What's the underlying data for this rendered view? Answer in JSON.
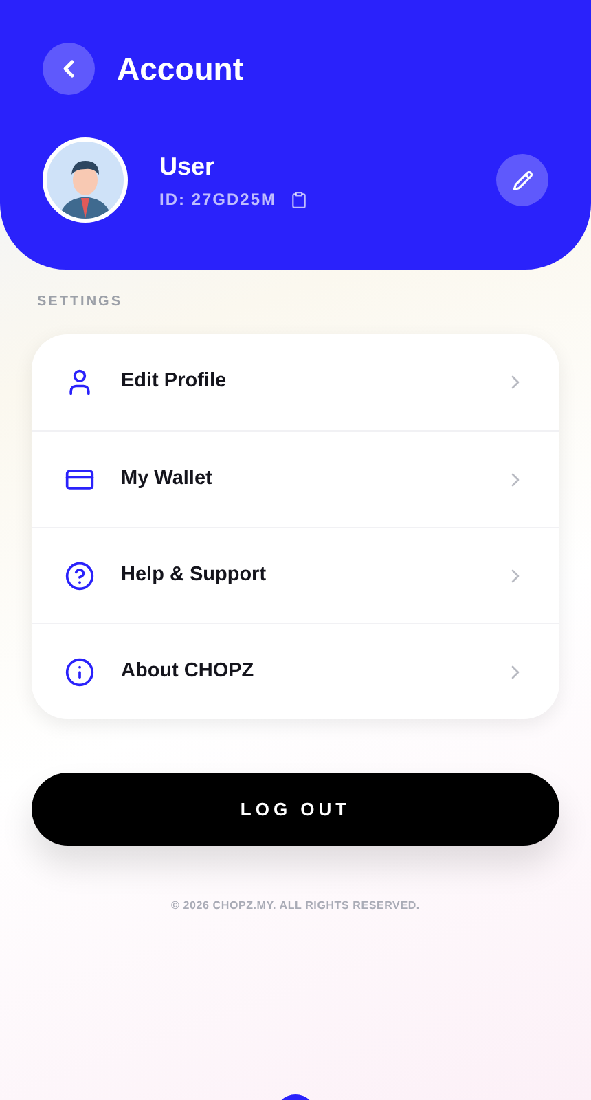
{
  "header": {
    "title": "Account",
    "user_name": "User",
    "user_id": "ID: 27GD25M"
  },
  "section_label": "SETTINGS",
  "menu": [
    {
      "kind": "profile",
      "label": "Edit Profile"
    },
    {
      "kind": "wallet",
      "label": "My Wallet"
    },
    {
      "kind": "help",
      "label": "Help & Support"
    },
    {
      "kind": "info",
      "label": "About CHOPZ"
    }
  ],
  "logout_button": "LOG OUT",
  "footer": "© 2026 CHOPZ.MY. ALL RIGHTS RESERVED."
}
